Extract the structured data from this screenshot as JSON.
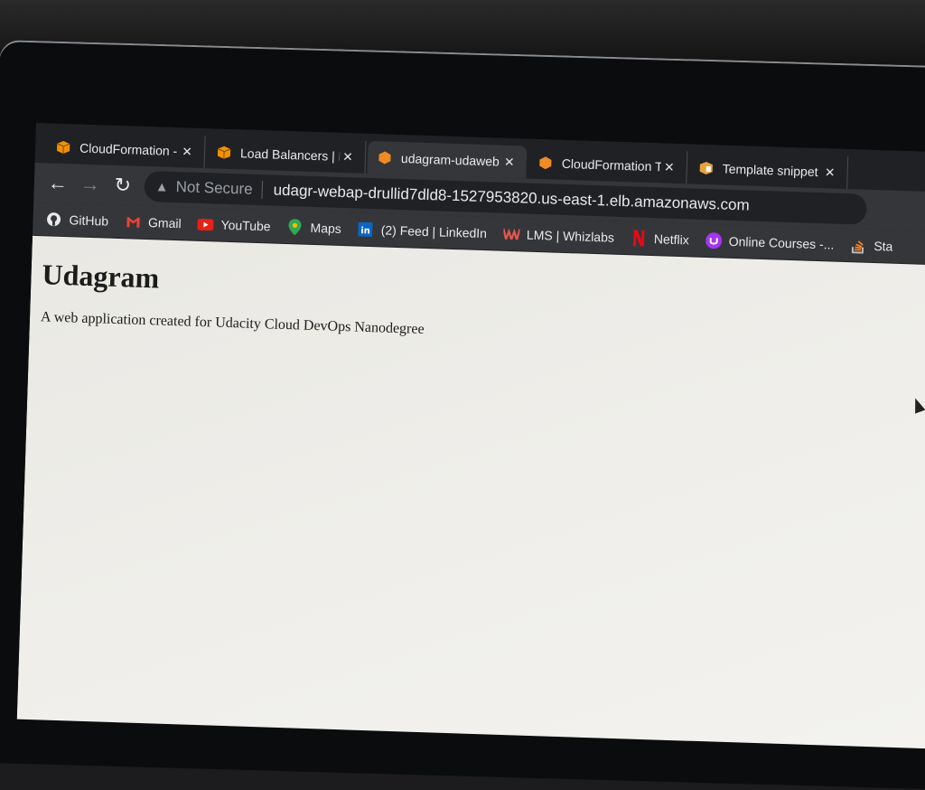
{
  "tabs": [
    {
      "title": "CloudFormation -",
      "icon": "aws-box-icon",
      "close": "×"
    },
    {
      "title": "Load Balancers | E",
      "icon": "aws-box-icon",
      "close": "×"
    },
    {
      "title": "udagram-udaweb",
      "icon": "aws-cloudformation-icon",
      "close": "×"
    },
    {
      "title": "CloudFormation T",
      "icon": "aws-cloudformation-icon",
      "close": "×"
    },
    {
      "title": "Template snippet",
      "icon": "aws-docs-icon",
      "close": "×"
    }
  ],
  "toolbar": {
    "back": "←",
    "forward": "→",
    "reload": "↻",
    "security_icon": "▲",
    "security_label": "Not Secure",
    "url": "udagr-webap-drullid7dld8-1527953820.us-east-1.elb.amazonaws.com"
  },
  "bookmarks": [
    {
      "label": "GitHub",
      "icon": "github-icon"
    },
    {
      "label": "Gmail",
      "icon": "gmail-icon"
    },
    {
      "label": "YouTube",
      "icon": "youtube-icon"
    },
    {
      "label": "Maps",
      "icon": "maps-icon"
    },
    {
      "label": "(2) Feed | LinkedIn",
      "icon": "linkedin-icon"
    },
    {
      "label": "LMS | Whizlabs",
      "icon": "whizlabs-icon"
    },
    {
      "label": "Netflix",
      "icon": "netflix-icon"
    },
    {
      "label": "Online Courses -...",
      "icon": "udemy-icon"
    },
    {
      "label": "Sta",
      "icon": "stackoverflow-icon"
    }
  ],
  "page": {
    "heading": "Udagram",
    "description": "A web application created for Udacity Cloud DevOps Nanodegree"
  },
  "colors": {
    "aws_orange": "#f29100",
    "youtube_red": "#e62117",
    "linkedin_blue": "#0a66c2",
    "netflix_red": "#e50914",
    "udemy_purple": "#a435f0"
  }
}
